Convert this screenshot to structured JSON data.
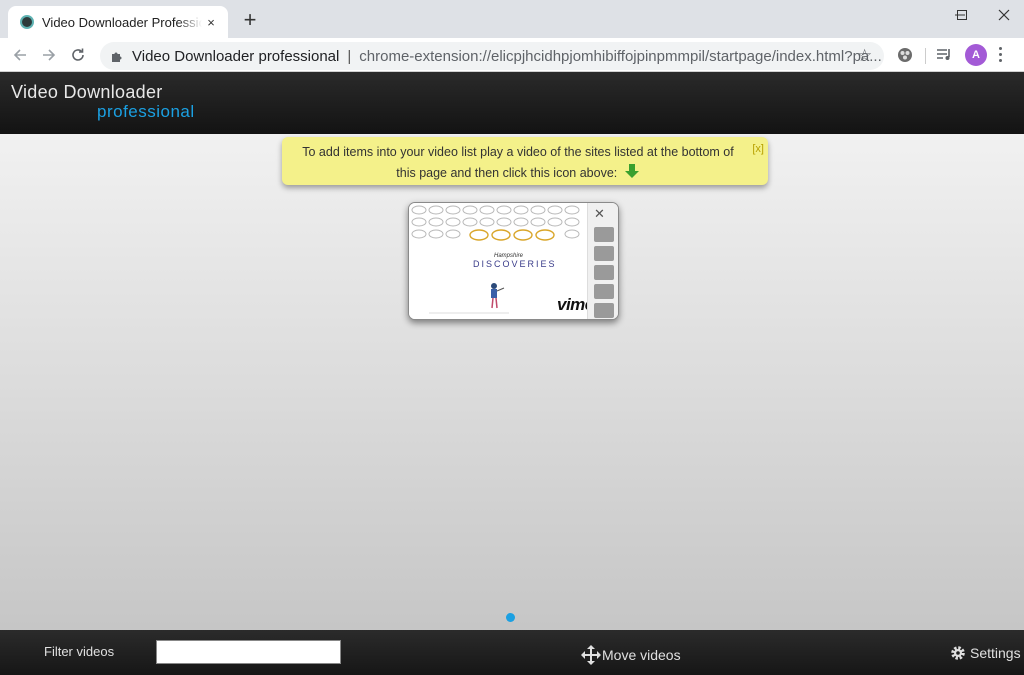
{
  "browser": {
    "tab": {
      "title": "Video Downloader Professional",
      "close_icon": "×"
    },
    "new_tab_icon": "+",
    "window_controls": {
      "minimize": "—",
      "maximize": "☐",
      "close": "✕"
    },
    "omnibox": {
      "extension_name": "Video Downloader professional",
      "separator": "|",
      "url": "chrome-extension://elicpjhcidhpjomhibiffojpinpmmpil/startpage/index.html?pa..."
    },
    "avatar_letter": "A"
  },
  "app": {
    "logo_line1": "Video Downloader",
    "logo_line2": "professional",
    "tip": {
      "text": "To add items into your video list play a video of the sites listed at the bottom of this page and then click this icon above:",
      "close_label": "[x]"
    },
    "video_card": {
      "brand": "vimeo",
      "title_small": "Hampshire",
      "title_big": "DISCOVERIES"
    },
    "footer": {
      "filter_label": "Filter videos",
      "filter_value": "",
      "move_label": "Move videos",
      "settings_label": "Settings"
    }
  },
  "colors": {
    "accent": "#1ba0e2",
    "tip_background": "#f4f18a",
    "header_background": "#1b1b1b",
    "arrow_green": "#3aa02e"
  }
}
